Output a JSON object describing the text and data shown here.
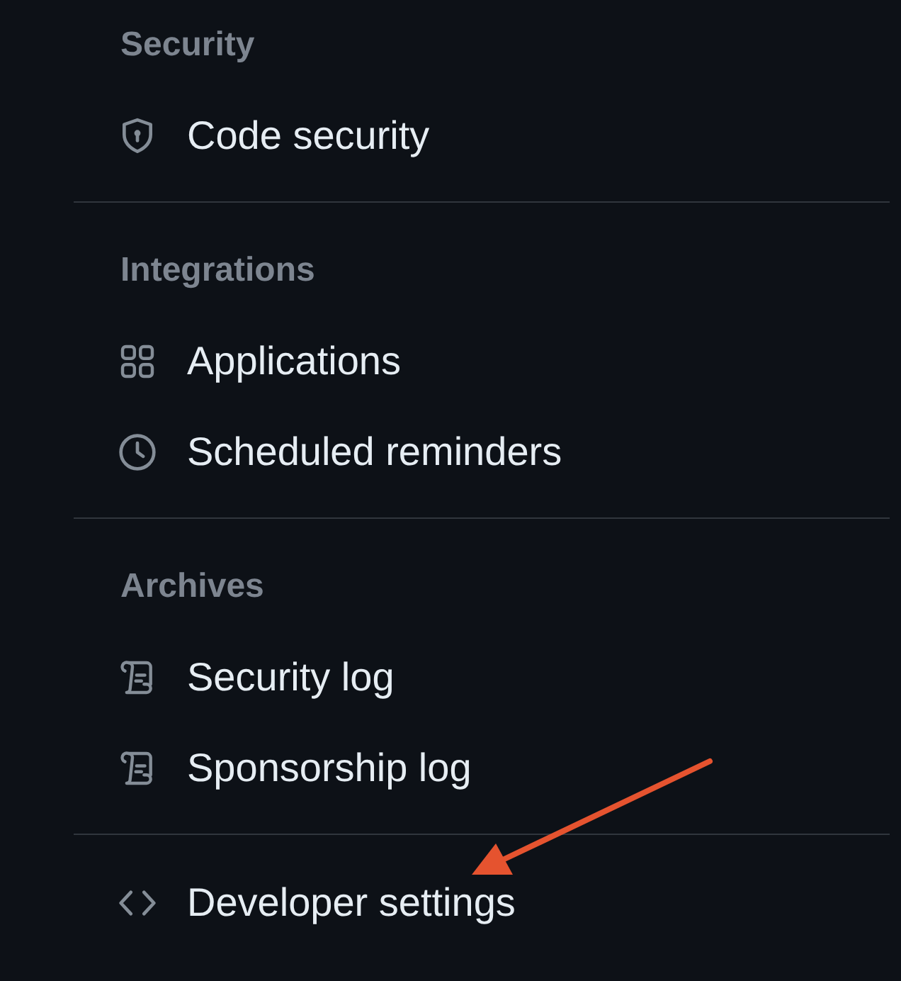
{
  "sections": [
    {
      "heading": "Security",
      "items": [
        {
          "label": "Code security",
          "kind": "shield"
        }
      ]
    },
    {
      "heading": "Integrations",
      "items": [
        {
          "label": "Applications",
          "kind": "apps"
        },
        {
          "label": "Scheduled reminders",
          "kind": "clock"
        }
      ]
    },
    {
      "heading": "Archives",
      "items": [
        {
          "label": "Security log",
          "kind": "log"
        },
        {
          "label": "Sponsorship log",
          "kind": "log"
        }
      ]
    },
    {
      "items": [
        {
          "label": "Developer settings",
          "kind": "code"
        }
      ]
    }
  ],
  "annotations": [
    {
      "kind": "arrow"
    }
  ]
}
